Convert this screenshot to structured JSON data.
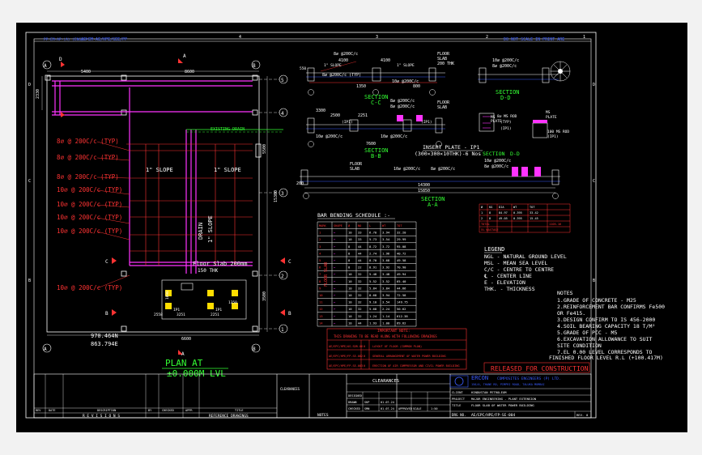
{
  "title_strip": {
    "ref": "PP-EM-AP-(A) (ENG)-P",
    "doc_no": "AE-EM-AE/HPE/GEE/PP",
    "page": "DRG No.",
    "note": "DO NOT SCALE IN PRINT ARE"
  },
  "grid_numbers": [
    "4",
    "3",
    "2",
    "1"
  ],
  "grid_letters": [
    "D",
    "C",
    "B",
    "A"
  ],
  "plan": {
    "title": "PLAN AT",
    "level": "±0.000M LVL",
    "dims_top": [
      "5400",
      "8600"
    ],
    "dim_left": "2330",
    "dim_bottom_a": "2200",
    "dim_bottom_b": "6600",
    "dims_right": [
      "5500",
      "15300",
      "3500"
    ],
    "axes_letters": [
      "A",
      "B"
    ],
    "axes_numbers": [
      "5",
      "4",
      "3",
      "2",
      "1"
    ],
    "rebar_labels": [
      "8⌀ @ 200C/c (TYP)",
      "8⌀ @ 200C/c (TYP)",
      "8⌀ @ 200C/c (TYP)",
      "10⌀ @ 200C/c (TYP)",
      "10⌀ @ 200C/c (TYP)",
      "10⌀ @ 200C/c (TYP)",
      "10⌀ @ 200C/c (TYP)"
    ],
    "slope_left": "1\" SLOPE",
    "slope_right": "1\" SLOPE",
    "drain_label": "DRAIN",
    "drain_slope": "1\" SLOPE",
    "existing_drain": "EXISTING DRAIN",
    "floor_slab": "Floor Slab 200mm",
    "floor_slab_sub": "150 THK",
    "ip_labels": [
      "IP1",
      "IP1",
      "IP1",
      "IP1"
    ],
    "dims_inner": [
      "1090",
      "2558",
      "3251",
      "2251",
      "1350"
    ],
    "levels": [
      "970.464N",
      "863.794E"
    ],
    "section_marks": [
      "A",
      "A",
      "B",
      "B",
      "C",
      "C",
      "D",
      "D"
    ]
  },
  "sections": {
    "cc": {
      "title": "SECTION",
      "sub": "C-C",
      "labels": [
        "8⌀ @200C/c",
        "4100",
        "4100",
        "1\" SLOPE",
        "1\" SLOPE",
        "FLOOR",
        "SLAB",
        "200 THK",
        "8⌀ @200C/c (TYP)",
        "10⌀ @200C/c",
        "1350",
        "550",
        "800"
      ]
    },
    "bb": {
      "title": "SECTION",
      "sub": "B-B",
      "labels": [
        "8⌀ @200C/c",
        "8⌀ @200C/c",
        "FLOOR",
        "SLAB",
        "3300",
        "2500",
        "2251",
        "(IP1)",
        "(IP1)",
        "10⌀ @200C/c",
        "10⌀ @200C/c",
        "7600"
      ]
    },
    "dd": {
      "title": "SECTION",
      "sub": "D-D",
      "labels": [
        "10⌀ @200C/c",
        "8⌀ @200C/c",
        "MS",
        "PLATE",
        "(IP1)",
        "8⌀ MS ROD",
        "(TYP)",
        "MS",
        "PLATE",
        "100 MS ROD",
        "(IP1)"
      ]
    },
    "aa": {
      "title": "SECTION",
      "sub": "A-A",
      "labels": [
        "FLOOR",
        "SLAB",
        "10⌀ @200C/c",
        "8⌀ @200C/c",
        "200",
        "14300",
        "15850",
        "10⌀ @200C/c",
        "8⌀ @200C/c"
      ]
    },
    "insert_plate": {
      "title": "INSERT PLATE - IP1",
      "sub": "(300×300×10THK)-6 Nos"
    }
  },
  "bbs": {
    "title": "BAR BENDING SCHEDULE :-",
    "side_label": "FLOOR SLAB",
    "headers": [
      "MARK",
      "SHAPE",
      "Ø",
      "NO",
      "L",
      "WT",
      "TOT"
    ],
    "rows": [
      [
        "1",
        "⌐",
        "10",
        "33",
        "6.70",
        "3.94",
        "32.20"
      ],
      [
        "2",
        "⌐",
        "10",
        "33",
        "5.73",
        "3.54",
        "29.99"
      ],
      [
        "3",
        "⌐",
        "8",
        "44",
        "8.72",
        "3.72",
        "95.08"
      ],
      [
        "4",
        "⌐",
        "8",
        "44",
        "2.74",
        "1.96",
        "40.72"
      ],
      [
        "5",
        "⌐",
        "8",
        "44",
        "8.70",
        "3.68",
        "49.58"
      ],
      [
        "6",
        "⌐",
        "8",
        "22",
        "8.91",
        "3.92",
        "70.90"
      ],
      [
        "7",
        "⌐",
        "10",
        "32",
        "5.48",
        "3.48",
        "49.94"
      ],
      [
        "8",
        "⌐",
        "10",
        "32",
        "5.52",
        "3.52",
        "65.40"
      ],
      [
        "9",
        "⌐",
        "10",
        "32",
        "5.84",
        "3.84",
        "44.66"
      ],
      [
        "10",
        "⌐",
        "10",
        "32",
        "8.68",
        "3.94",
        "72.58"
      ],
      [
        "11",
        "⌐",
        "10",
        "32",
        "9.10",
        "3.54",
        "149.75"
      ],
      [
        "12",
        "⌐",
        "10",
        "32",
        "5.68",
        "2.24",
        "50.62"
      ],
      [
        "13",
        "⌐",
        "10",
        "32",
        "1.24",
        "1.14",
        "612.38"
      ],
      [
        "14",
        "⌐",
        "10",
        "44",
        "1.93",
        "1.00",
        "69.62"
      ]
    ]
  },
  "summary_table": {
    "headers": [
      "Ø",
      "KG",
      "DIA",
      "WT",
      "TOT"
    ],
    "rows": [
      [
        "1",
        "8",
        "84.97",
        "0.395",
        "33.42"
      ],
      [
        "2",
        "8",
        "49.05",
        "0.395",
        "15.45"
      ]
    ],
    "total_label": "TOTAL",
    "total_value": "1105.16",
    "note": "5% WASTAGE"
  },
  "legend": {
    "title": "LEGEND",
    "items": [
      "NGL  - NATURAL GROUND LEVEL",
      "MSL  - MEAN SEA LEVEL",
      "C/C  - CENTRE TO CENTRE",
      "℄   - CENTER LINE",
      "E   - ELEVATION",
      "THK. - THICKNESS"
    ]
  },
  "notes": {
    "title": "NOTES",
    "items": [
      "1.GRADE OF CONCRETE - M25",
      "2.REINFORCEMENT BAR CONFIRMS  Fe500",
      "   OR Fe415.",
      "3.DESIGN CONFIRM TO IS 456-2000",
      "4.SOIL BEARING CAPACITY 18 T/M²",
      "5.GRADE OF PCC - M5",
      "6.EXCAVATION ALLOWANCE TO SUIT",
      "   SITE CONDITION",
      "7.EL 0.00 LEVEL CORRESPONDS TO",
      "FINISHED FLOOR LEVEL R.L (+100.417M)"
    ]
  },
  "important_note": {
    "title": "IMPORTANT NOTE:",
    "line": "THIS DRAWING TO BE READ ALONG WITH FOLLOWING DRAWINGS",
    "headers": [
      "DRG. NO.",
      "REV",
      "TITLE"
    ],
    "rows": [
      [
        "AE/EPC/HPE/AS-SDR-06",
        "0",
        "LAYOUT OF FLOOR (COMMON PLAN)"
      ],
      [
        "AE/EPC/HPE/FP-SE-002",
        "0",
        "GENERAL ARRANGEMENT OF WATER POWER BUILDING"
      ],
      [
        "AE/EPC/HPE/FP-SE-003",
        "0",
        "ERECTION OF AIR COMPRESSOR AND CIVIL POWER BUILDING"
      ]
    ]
  },
  "released": "RELEASED FOR CONSTRUCTION",
  "company": {
    "name": "ERCON",
    "full": "COMPOSITES ENGINEERS (P) LTD.",
    "addr": "150/A, THANE RD, PIMPRI ROAD, TALUKA MUMBAI",
    "client_label": "CLIENT",
    "client": "HINDUSTAN PETROLEUM",
    "project_label": "PROJECT",
    "project": "MAJOR ENGINEERING - PLANT EXTENSION",
    "title_label": "TITLE",
    "title": "FLOOR SLAB OF WATER POWER BUILDING",
    "drg_label": "DRG NO.",
    "drg_no": "AE/EPC/HPE/FP-SE-004",
    "rev_label": "REV.",
    "rev": "0"
  },
  "approvals": {
    "headers": [
      "",
      "NAME",
      "SIGN",
      "DATE"
    ],
    "rows": [
      [
        "DESIGNED",
        "",
        "",
        ""
      ],
      [
        "DRAWN",
        "SKP",
        "",
        "01.07.24"
      ],
      [
        "CHECKED",
        "SMN",
        "",
        "01.07.24"
      ],
      [
        "APPROVED",
        "",
        "",
        ""
      ]
    ],
    "scale_label": "SCALE",
    "scale": "1:50",
    "clearances": "CLEARANCES"
  },
  "revisions": {
    "headers": [
      "REV",
      "DATE",
      "DRAWN",
      "DESCRIPTION",
      "BY",
      "CHECKED",
      "APPR"
    ],
    "footer": "R E V I S I O N S",
    "refs": "REFERENCE DRAWINGS",
    "title_col": "TITLE"
  },
  "notes_box": "NOTES",
  "legend_box": "LEGEND"
}
